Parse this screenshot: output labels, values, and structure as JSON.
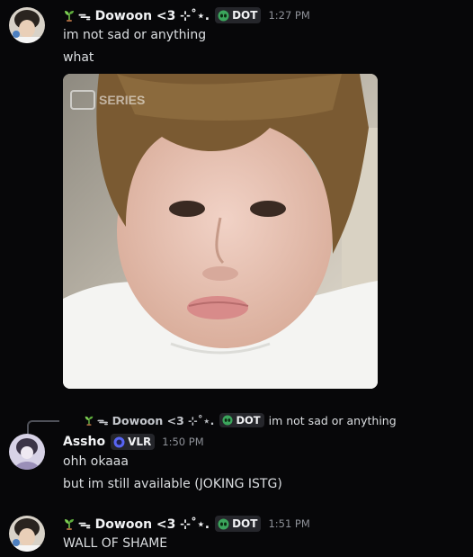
{
  "messages": [
    {
      "author": "ᯓ Dowoon <3 ⊹˚⋆.",
      "tag": "DOT",
      "time": "1:27 PM",
      "lines": [
        "im not sad or anything",
        "what"
      ],
      "image": {
        "watermark": "SERIES"
      }
    },
    {
      "reply": {
        "author": "ᯓ Dowoon <3 ⊹˚⋆.",
        "tag": "DOT",
        "text": "im not sad or anything"
      },
      "author": "Assho",
      "tag": "VLR",
      "time": "1:50 PM",
      "lines": [
        "ohh okaaa",
        "but im still available (JOKING ISTG)"
      ]
    },
    {
      "author": "ᯓ Dowoon <3 ⊹˚⋆.",
      "tag": "DOT",
      "time": "1:51 PM",
      "lines": [
        "WALL OF SHAME"
      ]
    }
  ],
  "colors": {
    "background": "#070709",
    "username": "#f2f3f5",
    "timestamp": "#8e9198",
    "text": "#dbdee1",
    "dot_tag_icon": "#3ba55c",
    "vlr_tag_icon": "#5865f2"
  },
  "icons": {
    "sprout": "sprout-icon",
    "dot_tag": "alien-icon",
    "vlr_tag": "blue-orb-icon"
  }
}
